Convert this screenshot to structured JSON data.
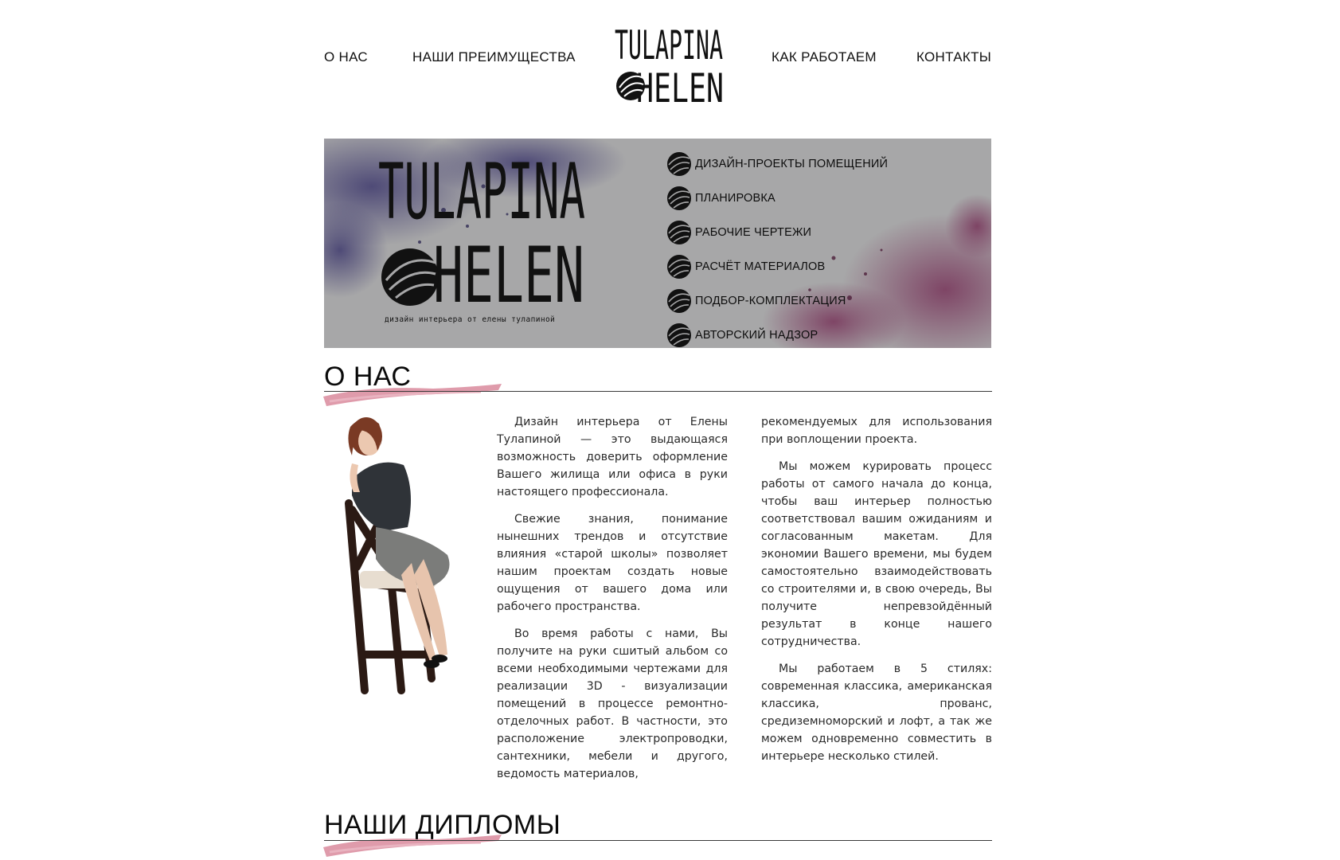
{
  "nav": {
    "about": "О НАС",
    "advantages": "НАШИ ПРЕИМУЩЕСТВА",
    "how_we_work": "КАК РАБОТАЕМ",
    "contacts": "КОНТАКТЫ"
  },
  "logo": {
    "line1": "TULAPINA",
    "line2": "HELEN",
    "tagline": "дизайн интерьера от елены тулапиной"
  },
  "banner": {
    "services": [
      "ДИЗАЙН-ПРОЕКТЫ ПОМЕЩЕНИЙ",
      "ПЛАНИРОВКА",
      "РАБОЧИЕ ЧЕРТЕЖИ",
      "РАСЧЁТ МАТЕРИАЛОВ",
      "ПОДБОР-КОМПЛЕКТАЦИЯ",
      "АВТОРСКИЙ НАДЗОР"
    ]
  },
  "about": {
    "title": "О НАС",
    "paragraphs": [
      "Дизайн интерьера от Елены Тулапиной — это выдающаяся возможность доверить оформление Вашего жилища или офиса в руки настоящего профессионала.",
      "Свежие знания, понимание нынешних трендов и отсутствие влияния «старой школы» позволяет нашим проектам создать новые ощущения от вашего дома или рабочего пространства.",
      "Во время работы с нами, Вы получите на руки сшитый альбом со всеми необходимыми чертежами для реализации 3D - визуализации помещений в процессе ремонтно-отделочных работ. В частности, это расположение электропроводки, сантехники, мебели и другого, ведомость материалов,",
      "рекомендуемых для использования при воплощении проекта.",
      "Мы можем курировать процесс работы от самого начала до конца, чтобы ваш интерьер полностью соответствовал вашим ожиданиям и согласованным макетам. Для экономии Вашего времени, мы будем самостоятельно взаимодействовать со строителями и, в свою очередь, Вы получите непревзойдённый результат в конце нашего сотрудничества.",
      "Мы работаем в 5 стилях: современная классика, американская классика, прованс, средиземноморский и лофт, а так же можем одновременно совместить в интерьере несколько стилей."
    ]
  },
  "diplomas": {
    "title": "НАШИ ДИПЛОМЫ"
  },
  "colors": {
    "banner_bg": "#a7a7a8",
    "ink_purple": "#3f3a6e",
    "ink_plum": "#7a3a5e",
    "brush_pink": "#d98a9c"
  }
}
